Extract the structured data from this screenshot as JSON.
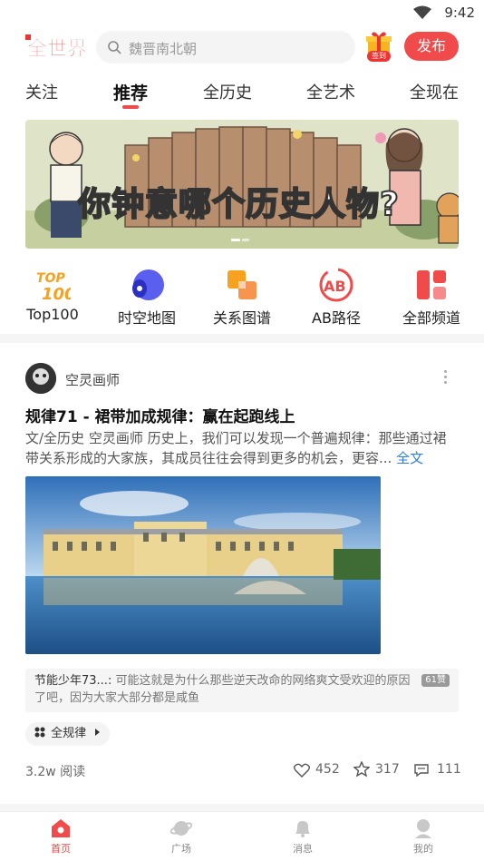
{
  "status": {
    "time": "9:42"
  },
  "header": {
    "logo_text": "全世界",
    "search_placeholder": "魏晋南北朝",
    "gift_tag": "签到",
    "publish_label": "发布"
  },
  "tabs": [
    {
      "label": "关注"
    },
    {
      "label": "推荐",
      "active": true
    },
    {
      "label": "全历史"
    },
    {
      "label": "全艺术"
    },
    {
      "label": "全现在"
    }
  ],
  "banner": {
    "text": "你钟意哪个历史人物?"
  },
  "channels": [
    {
      "label": "Top100",
      "icon": "top100-icon",
      "icon_text": "TOP 100"
    },
    {
      "label": "时空地图",
      "icon": "spacetime-map-icon"
    },
    {
      "label": "关系图谱",
      "icon": "relation-graph-icon"
    },
    {
      "label": "AB路径",
      "icon": "ab-path-icon",
      "icon_text": "AB"
    },
    {
      "label": "全部频道",
      "icon": "all-channels-icon"
    }
  ],
  "post": {
    "author": "空灵画师",
    "title": "规律71 - 裙带加成规律：赢在起跑线上",
    "body": "文/全历史 空灵画师 历史上，我们可以发现一个普遍规律：那些通过裙带关系形成的大家族，其成员往往会得到更多的机会，更容...",
    "full_text_link": "全文",
    "comment_user": "节能少年73...:",
    "comment_text": "可能这就是为什么那些逆天改命的网络爽文受欢迎的原因了吧，因为大家大部分都是咸鱼",
    "comment_badge": "61赞",
    "tag": "全规律",
    "reads": "3.2w",
    "reads_label": "阅读",
    "likes": "452",
    "stars": "317",
    "comments": "111"
  },
  "bottom_nav": [
    {
      "label": "首页",
      "active": true
    },
    {
      "label": "广场"
    },
    {
      "label": "消息"
    },
    {
      "label": "我的"
    }
  ],
  "colors": {
    "accent": "#f04a4a",
    "link": "#2f7fd8"
  }
}
